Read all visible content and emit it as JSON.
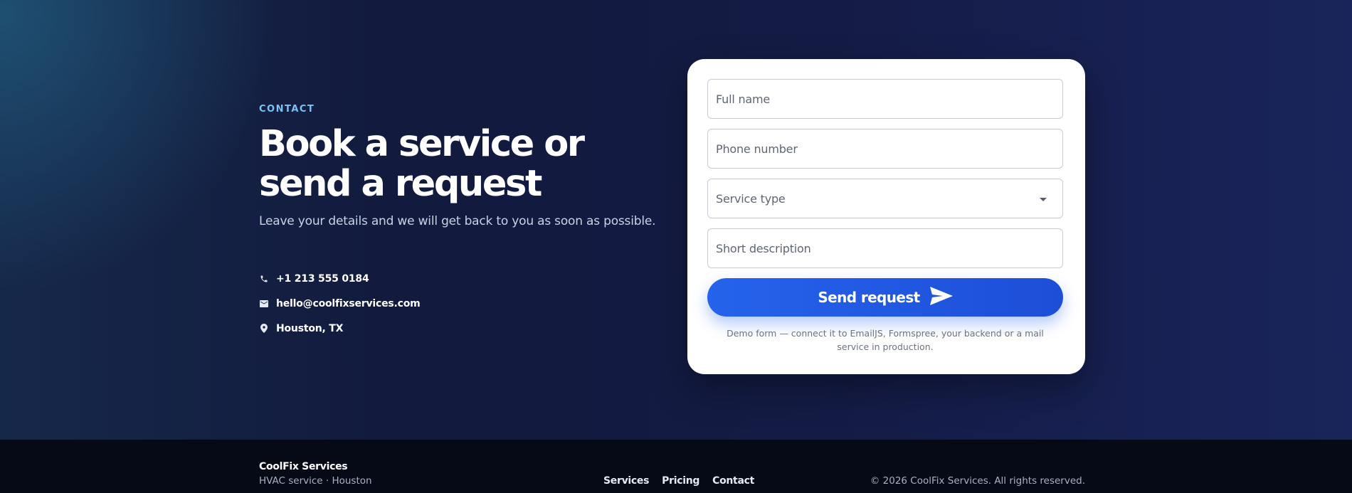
{
  "contact": {
    "eyebrow": "CONTACT",
    "heading": "Book a service or send a request",
    "subtitle": "Leave your details and we will get back to you as soon as possible.",
    "items": [
      {
        "icon": "phone-icon",
        "text": "+1 213 555 0184"
      },
      {
        "icon": "mail-icon",
        "text": "hello@coolfixservices.com"
      },
      {
        "icon": "location-pin-icon",
        "text": "Houston, TX"
      }
    ]
  },
  "form": {
    "full_name_placeholder": "Full name",
    "phone_placeholder": "Phone number",
    "service_type_placeholder": "Service type",
    "description_placeholder": "Short description",
    "submit_label": "Send request",
    "submit_icon": "send-icon",
    "note": "Demo form — connect it to EmailJS, Formspree, your backend or a mail service in production."
  },
  "footer": {
    "brand_name": "CoolFix Services",
    "tagline": "HVAC service · Houston",
    "nav": [
      "Services",
      "Pricing",
      "Contact"
    ],
    "copyright": "© 2026 CoolFix Services. All rights reserved."
  },
  "colors": {
    "accent": "#2563eb",
    "eyebrow": "#7cc3f5",
    "background": "#141b3d",
    "footer_bg": "#060a17"
  }
}
